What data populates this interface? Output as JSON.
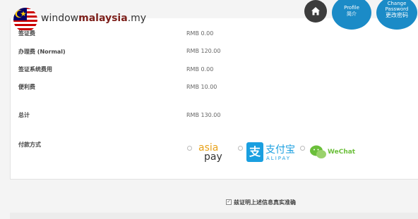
{
  "header": {
    "logo_prefix": "window",
    "logo_strong": "malaysia",
    "logo_suffix": ".my",
    "profile_en": "Profile",
    "profile_cn": "简介",
    "pwd_en_1": "Change",
    "pwd_en_2": "Password",
    "pwd_cn": "更改密码"
  },
  "fees": [
    {
      "label": "签证费",
      "value": "RMB 0.00"
    },
    {
      "label": "办理费 (Normal)",
      "value": "RMB 120.00"
    },
    {
      "label": "签证系统费用",
      "value": "RMB 0.00"
    },
    {
      "label": "便利费",
      "value": "RMB 10.00"
    }
  ],
  "total": {
    "label": "总计",
    "value": "RMB 130.00"
  },
  "payment": {
    "label": "付款方式",
    "options": [
      {
        "name": "asiapay",
        "text_top": "asia",
        "text_bottom": "pay"
      },
      {
        "name": "alipay",
        "text_cn": "支付宝",
        "text_en": "ALIPAY"
      },
      {
        "name": "wechat",
        "text": "WeChat"
      }
    ]
  },
  "confirm": {
    "label": "兹证明上述信息真实准确",
    "checked": true
  },
  "colors": {
    "accent": "#1b8bc7",
    "home": "#3c3c3c",
    "alipay": "#1a9fe0",
    "asiapay": "#e8a21a",
    "wechat": "#6bbf3a",
    "logo": "#7c1f1a"
  }
}
